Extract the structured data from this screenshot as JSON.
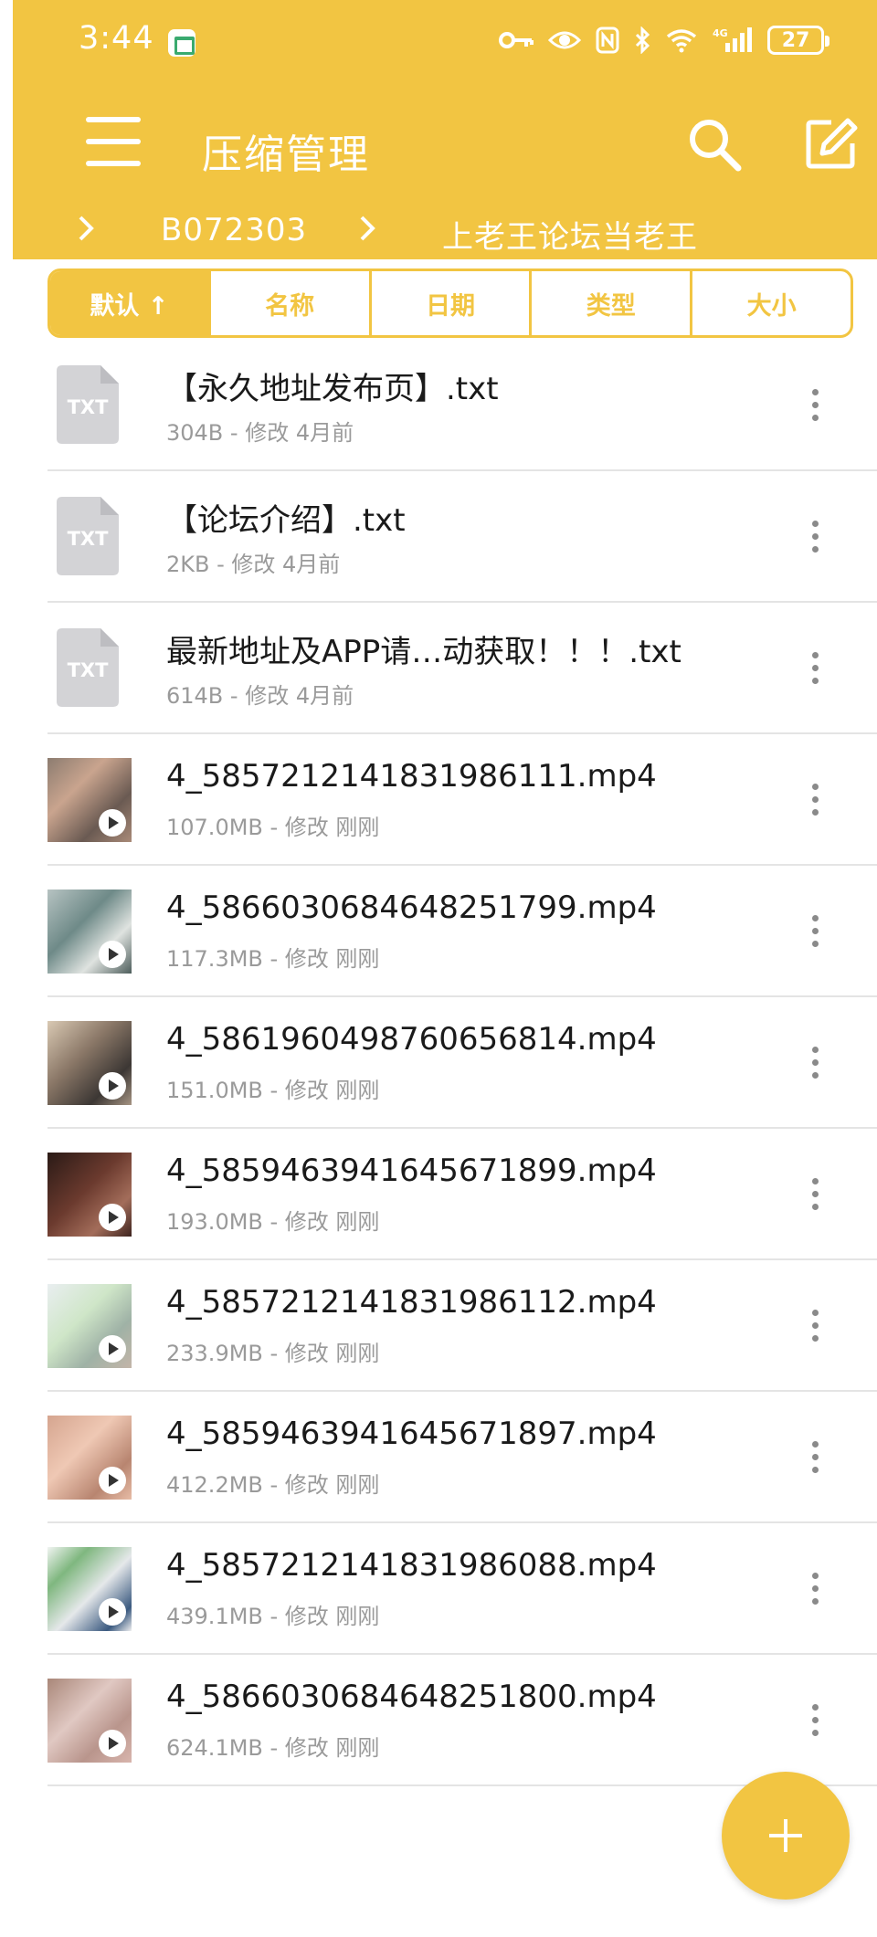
{
  "status_bar": {
    "time": "3:44",
    "battery": "27",
    "icons": [
      "key-icon",
      "eye-icon",
      "nfc-icon",
      "bluetooth-icon",
      "wifi-icon",
      "signal-icon",
      "battery-icon"
    ]
  },
  "header": {
    "title": "压缩管理",
    "icons": [
      "menu-icon",
      "search-icon",
      "edit-icon"
    ]
  },
  "breadcrumb": [
    "B072303",
    "上老王论坛当老王"
  ],
  "sort_tabs": [
    {
      "label": "默认 ↑",
      "active": true
    },
    {
      "label": "名称",
      "active": false
    },
    {
      "label": "日期",
      "active": false
    },
    {
      "label": "类型",
      "active": false
    },
    {
      "label": "大小",
      "active": false
    }
  ],
  "files": [
    {
      "type": "txt",
      "icon_label": "TXT",
      "name": "【永久地址发布页】.txt",
      "meta": "304B - 修改 4月前"
    },
    {
      "type": "txt",
      "icon_label": "TXT",
      "name": "【论坛介绍】.txt",
      "meta": "2KB - 修改 4月前"
    },
    {
      "type": "txt",
      "icon_label": "TXT",
      "name": "最新地址及APP请…动获取！！！.txt",
      "meta": "614B - 修改 4月前"
    },
    {
      "type": "video",
      "name": "4_5857212141831986111.mp4",
      "meta": "107.0MB - 修改 刚刚"
    },
    {
      "type": "video",
      "name": "4_5866030684648251799.mp4",
      "meta": "117.3MB - 修改 刚刚"
    },
    {
      "type": "video",
      "name": "4_5861960498760656814.mp4",
      "meta": "151.0MB - 修改 刚刚"
    },
    {
      "type": "video",
      "name": "4_5859463941645671899.mp4",
      "meta": "193.0MB - 修改 刚刚"
    },
    {
      "type": "video",
      "name": "4_5857212141831986112.mp4",
      "meta": "233.9MB - 修改 刚刚"
    },
    {
      "type": "video",
      "name": "4_5859463941645671897.mp4",
      "meta": "412.2MB - 修改 刚刚"
    },
    {
      "type": "video",
      "name": "4_5857212141831986088.mp4",
      "meta": "439.1MB - 修改 刚刚"
    },
    {
      "type": "video",
      "name": "4_5866030684648251800.mp4",
      "meta": "624.1MB - 修改 刚刚"
    }
  ],
  "fab": {
    "icon": "plus-icon"
  },
  "colors": {
    "accent": "#f2c542",
    "divider": "#e4e4e4",
    "meta_text": "#9a9a9a",
    "txt_icon": "#d3d3d6"
  }
}
